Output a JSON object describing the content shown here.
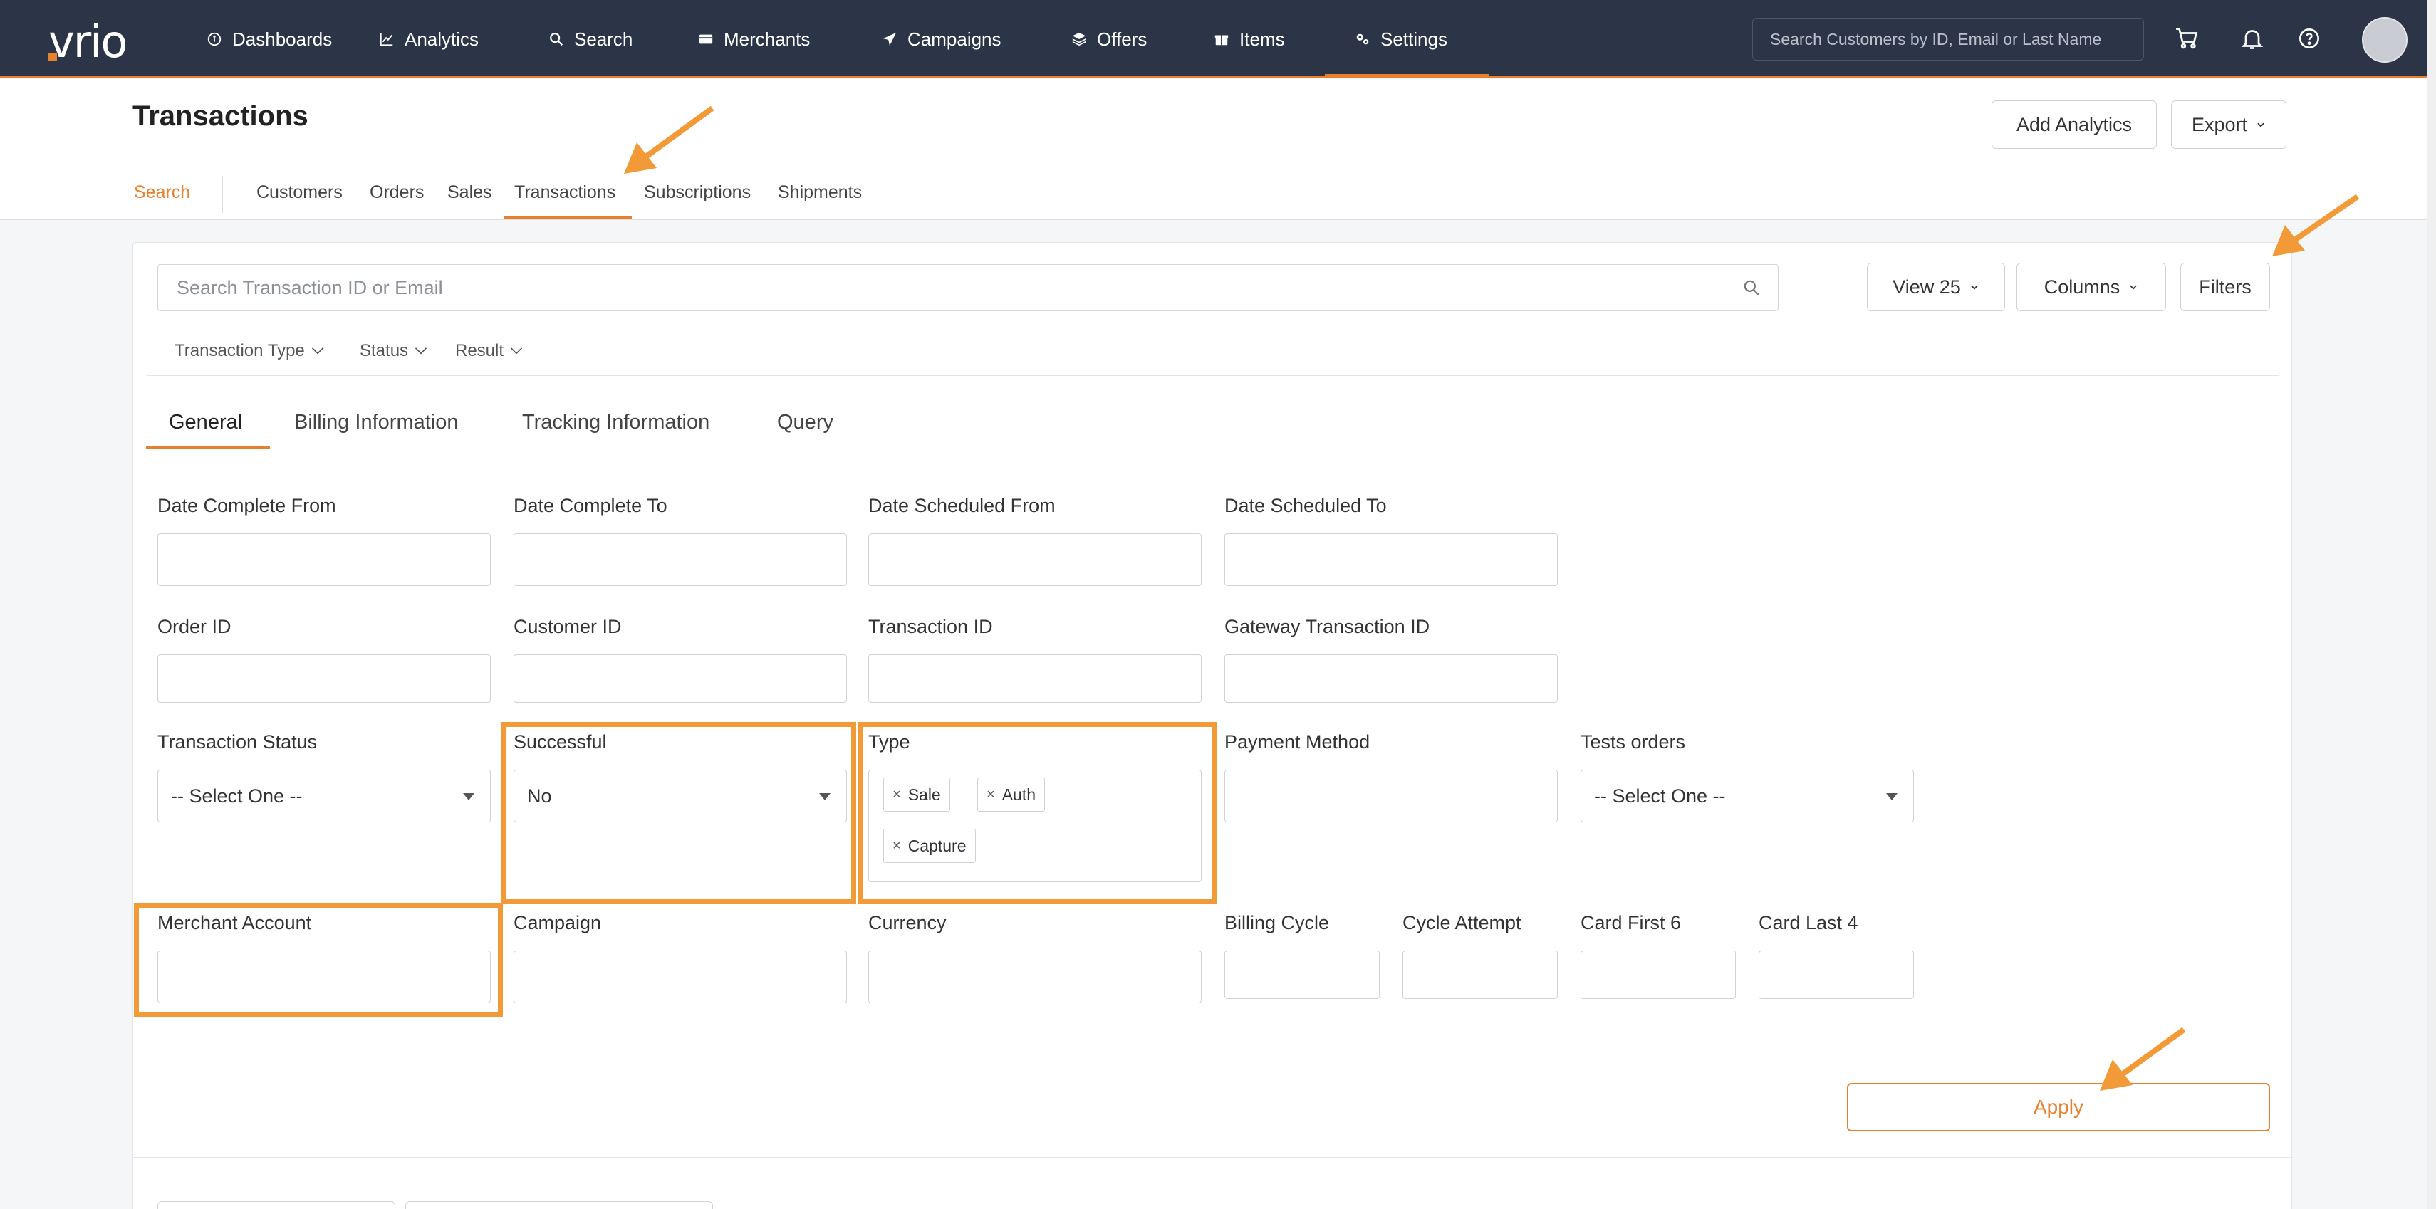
{
  "brand": {
    "logo_text": "vrio",
    "accent_color": "#e8812e",
    "nav_bg": "#2c3547"
  },
  "nav": {
    "items": [
      {
        "label": "Dashboards",
        "icon": "info-circle-icon"
      },
      {
        "label": "Analytics",
        "icon": "line-chart-icon"
      },
      {
        "label": "Search",
        "icon": "search-icon"
      },
      {
        "label": "Merchants",
        "icon": "card-icon"
      },
      {
        "label": "Campaigns",
        "icon": "paper-plane-icon"
      },
      {
        "label": "Offers",
        "icon": "layers-icon"
      },
      {
        "label": "Items",
        "icon": "gift-icon"
      },
      {
        "label": "Settings",
        "icon": "gears-icon"
      }
    ],
    "active": "Settings",
    "search_placeholder": "Search Customers by ID, Email or Last Name",
    "right_icons": [
      "cart-icon",
      "bell-icon",
      "help-icon"
    ]
  },
  "page": {
    "title": "Transactions",
    "add_analytics_label": "Add Analytics",
    "export_label": "Export"
  },
  "subnav": {
    "items": [
      "Search",
      "Customers",
      "Orders",
      "Sales",
      "Transactions",
      "Subscriptions",
      "Shipments"
    ],
    "active": "Transactions"
  },
  "toolbar": {
    "search_placeholder": "Search Transaction ID or Email",
    "view_label": "View 25",
    "columns_label": "Columns",
    "filters_label": "Filters"
  },
  "quick_filters": [
    "Transaction Type",
    "Status",
    "Result"
  ],
  "tabs": [
    "General",
    "Billing Information",
    "Tracking Information",
    "Query"
  ],
  "active_tab": "General",
  "form": {
    "date_complete_from": "Date Complete From",
    "date_complete_to": "Date Complete To",
    "date_scheduled_from": "Date Scheduled From",
    "date_scheduled_to": "Date Scheduled To",
    "order_id": "Order ID",
    "customer_id": "Customer ID",
    "transaction_id": "Transaction ID",
    "gateway_transaction_id": "Gateway Transaction ID",
    "transaction_status": {
      "label": "Transaction Status",
      "value": "-- Select One --"
    },
    "successful": {
      "label": "Successful",
      "value": "No"
    },
    "type": {
      "label": "Type",
      "tags": [
        "Sale",
        "Auth",
        "Capture"
      ]
    },
    "payment_method": "Payment Method",
    "tests_orders": {
      "label": "Tests orders",
      "value": "-- Select One --"
    },
    "merchant_account": "Merchant Account",
    "campaign": "Campaign",
    "currency": "Currency",
    "billing_cycle": "Billing Cycle",
    "cycle_attempt": "Cycle Attempt",
    "card_first_6": "Card First 6",
    "card_last_4": "Card Last 4"
  },
  "apply_label": "Apply",
  "annotation_color": "#f39a38"
}
